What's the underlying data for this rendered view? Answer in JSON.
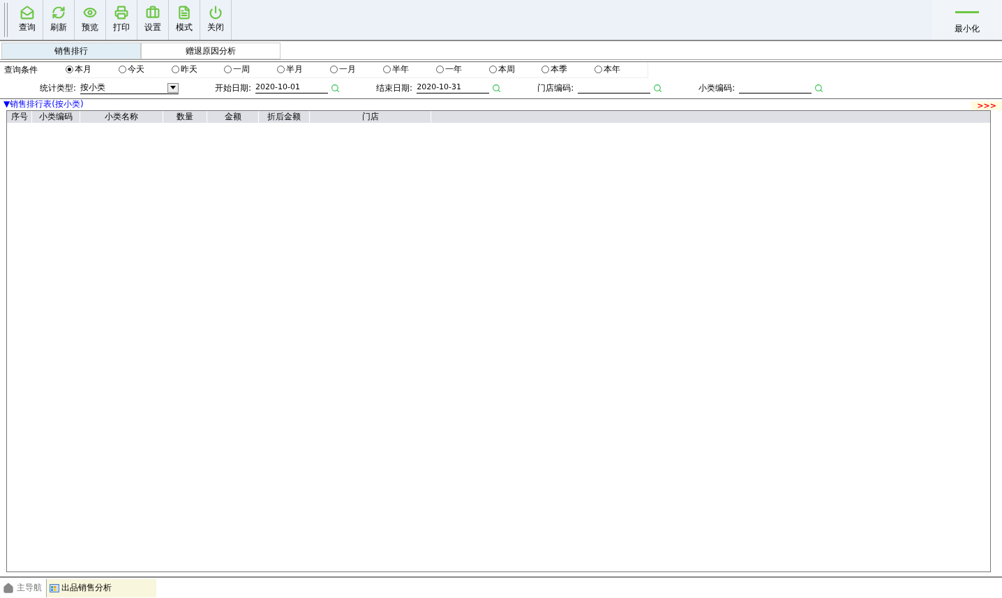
{
  "toolbar": {
    "buttons": [
      {
        "kind": "query",
        "label": "查询"
      },
      {
        "kind": "refresh",
        "label": "刷新"
      },
      {
        "kind": "preview",
        "label": "预览"
      },
      {
        "kind": "print",
        "label": "打印"
      },
      {
        "kind": "settings",
        "label": "设置"
      },
      {
        "kind": "mode",
        "label": "模式"
      },
      {
        "kind": "close",
        "label": "关闭"
      }
    ],
    "minimize": "最小化"
  },
  "tabs": [
    {
      "label": "销售排行",
      "selected": true
    },
    {
      "label": "赠退原因分析",
      "selected": false
    }
  ],
  "query": {
    "label": "查询条件",
    "periods": [
      {
        "label": "本月",
        "selected": true
      },
      {
        "label": "今天",
        "selected": false
      },
      {
        "label": "昨天",
        "selected": false
      },
      {
        "label": "一周",
        "selected": false
      },
      {
        "label": "半月",
        "selected": false
      },
      {
        "label": "一月",
        "selected": false
      },
      {
        "label": "半年",
        "selected": false
      },
      {
        "label": "一年",
        "selected": false
      },
      {
        "label": "本周",
        "selected": false
      },
      {
        "label": "本季",
        "selected": false
      },
      {
        "label": "本年",
        "selected": false
      }
    ],
    "type_label": "统计类型:",
    "type_value": "按小类",
    "fields": [
      {
        "label": "开始日期:",
        "value": "2020-10-01"
      },
      {
        "label": "结束日期:",
        "value": "2020-10-31"
      },
      {
        "label": "门店编码:"
      },
      {
        "label": "小类编码:"
      }
    ]
  },
  "report": {
    "title": "▼销售排行表(按小类)",
    "expand": ">>>",
    "columns": [
      "序号",
      "小类编码",
      "小类名称",
      "数量",
      "金额",
      "折后金额",
      "门店"
    ]
  },
  "taskbar": {
    "home": "主导航",
    "window": "出品销售分析"
  }
}
